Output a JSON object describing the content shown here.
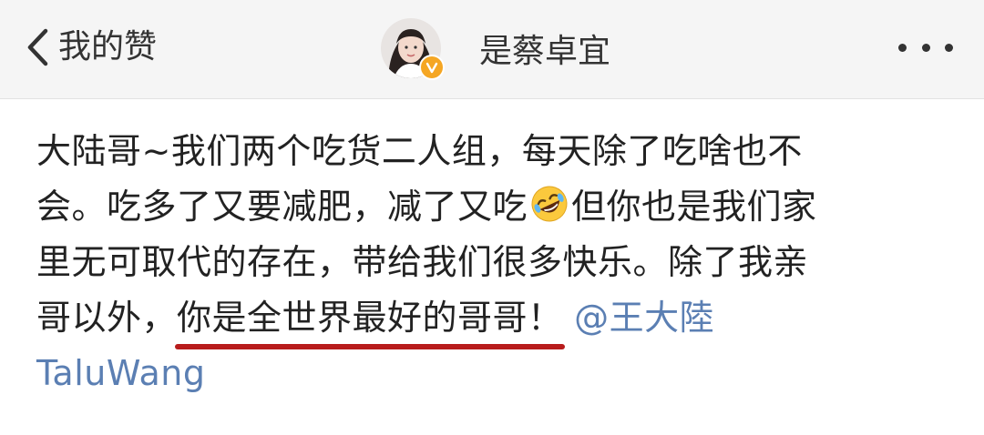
{
  "header": {
    "back_label": "我的赞",
    "username": "是蔡卓宜"
  },
  "post": {
    "line1": "大陆哥~我们两个吃货二人组，每天除了吃啥也不",
    "line2_a": "会。吃多了又要减肥，减了又吃",
    "line2_b": "但你也是我们家",
    "line3": "里无可取代的存在，带给我们很多快乐。除了我亲",
    "line4_a": "哥以外，",
    "line4_highlight": "你是全世界最好的哥哥！",
    "mention_line1": "@王大陸",
    "mention_line2": "TaluWang",
    "emoji": "rofl-emoji"
  },
  "colors": {
    "header_bg": "#f5f5f5",
    "text": "#222222",
    "mention": "#5b7fb3",
    "underline": "#b81c1c",
    "badge": "#f5a623"
  }
}
